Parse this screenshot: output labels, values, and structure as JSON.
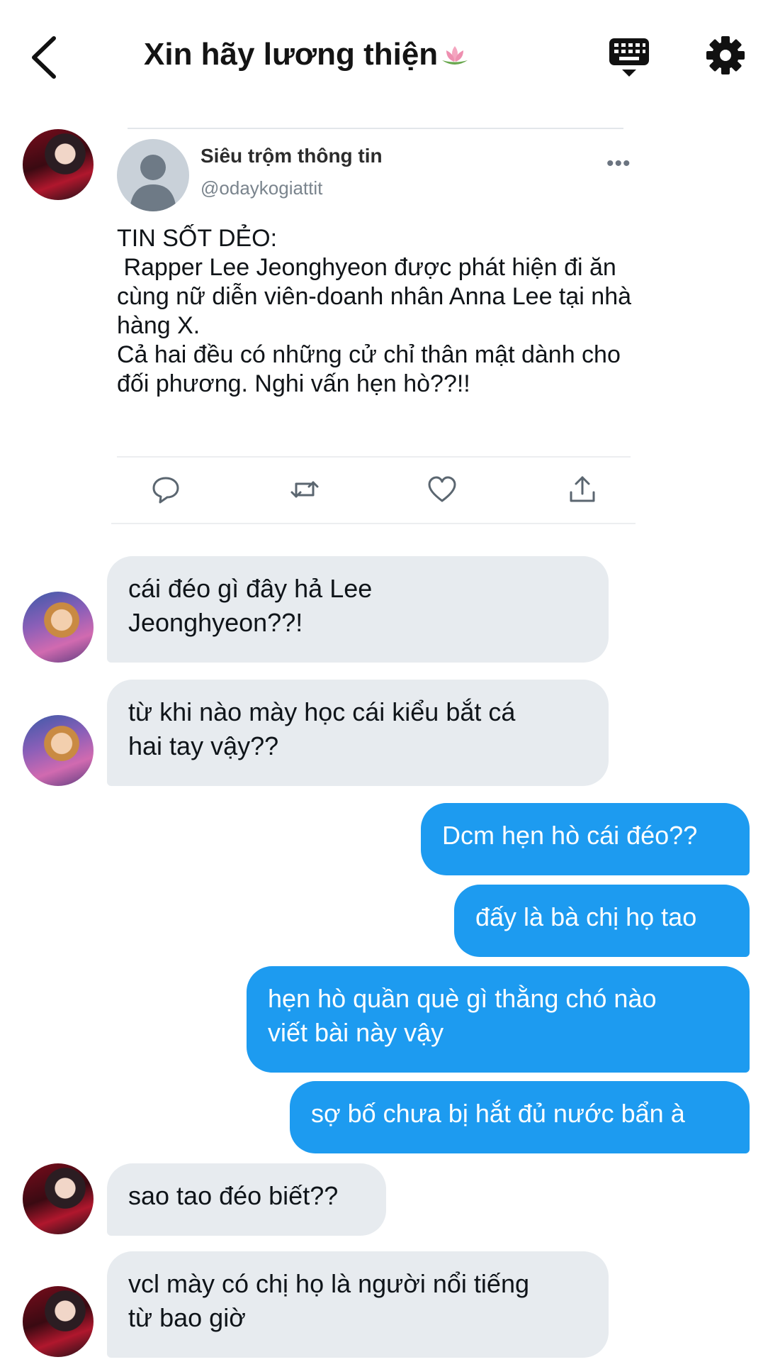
{
  "header": {
    "title": "Xin hãy lương thiện",
    "back_icon": "chevron-left-icon",
    "keyboard_icon": "keyboard-icon",
    "settings_icon": "gear-icon"
  },
  "tweet": {
    "author_name": "Siêu trộm thông tin",
    "author_handle": "@odaykogiattit",
    "more": "•••",
    "text": "TIN SỐT DẺO:\n Rapper Lee Jeonghyeon được phát hiện đi ăn cùng nữ diễn viên-doanh nhân Anna Lee tại nhà hàng X.\nCả hai đều có những cử chỉ thân mật dành cho đối phương. Nghi vấn hẹn hò??!!",
    "actions": [
      "reply-icon",
      "retweet-icon",
      "like-icon",
      "share-icon"
    ]
  },
  "messages": [
    {
      "side": "received",
      "text": "cái đéo gì đây hả Lee\nJeonghyeon??!"
    },
    {
      "side": "received",
      "text": "từ khi nào mày học cái kiểu bắt cá\nhai tay vậy??"
    },
    {
      "side": "sent",
      "text": "Dcm hẹn hò cái đéo??"
    },
    {
      "side": "sent",
      "text": "đấy là bà chị họ tao"
    },
    {
      "side": "sent",
      "text": "hẹn hò quần què gì thằng chó nào\nviết bài này vậy"
    },
    {
      "side": "sent",
      "text": "sợ bố chưa bị hắt đủ nước bẩn à"
    },
    {
      "side": "received",
      "text": "sao tao đéo biết??"
    },
    {
      "side": "received",
      "text": "vcl mày có chị họ là người nổi tiếng\ntừ bao giờ"
    }
  ],
  "colors": {
    "sent_bubble": "#1d9bf0",
    "received_bubble": "#e7ebef"
  }
}
